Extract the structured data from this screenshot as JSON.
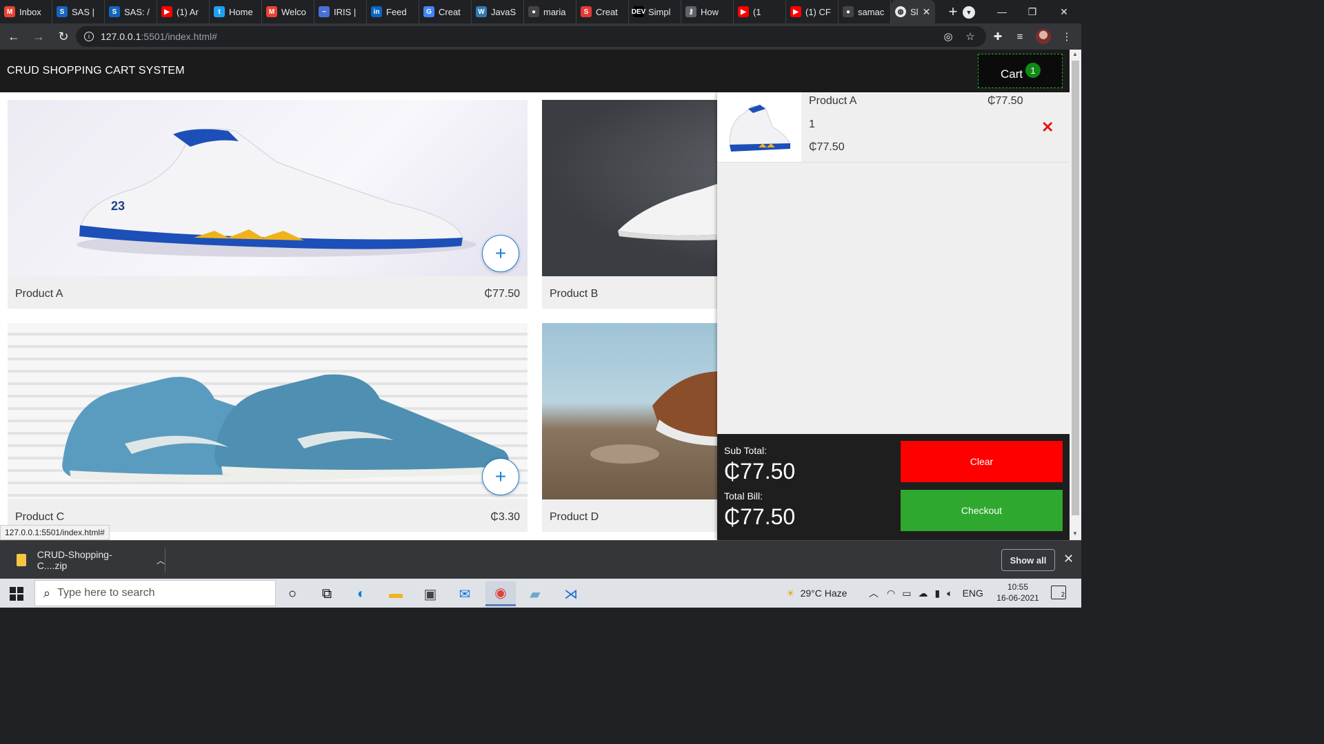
{
  "browser": {
    "tabs": [
      {
        "label": "Inbox",
        "icon": "gmail-icon",
        "color": "#ea4335",
        "glyph": "M"
      },
      {
        "label": "SAS |",
        "icon": "sas-icon",
        "color": "#1565c0",
        "glyph": "S"
      },
      {
        "label": "SAS: /",
        "icon": "sas-icon",
        "color": "#1565c0",
        "glyph": "S"
      },
      {
        "label": "(1) Ar",
        "icon": "youtube-icon",
        "color": "#ff0000",
        "glyph": "▶"
      },
      {
        "label": "Home",
        "icon": "twitter-icon",
        "color": "#1da1f2",
        "glyph": "t"
      },
      {
        "label": "Welco",
        "icon": "gmail-icon",
        "color": "#ea4335",
        "glyph": "M"
      },
      {
        "label": "IRIS |",
        "icon": "iris-icon",
        "color": "#4a6fd8",
        "glyph": "~"
      },
      {
        "label": "Feed",
        "icon": "linkedin-icon",
        "color": "#0a66c2",
        "glyph": "in"
      },
      {
        "label": "Creat",
        "icon": "google-icon",
        "color": "#4285f4",
        "glyph": "G"
      },
      {
        "label": "JavaS",
        "icon": "w3-icon",
        "color": "#2f7bb0",
        "glyph": "W"
      },
      {
        "label": "maria",
        "icon": "github-icon",
        "color": "#444444",
        "glyph": "●"
      },
      {
        "label": "Creat",
        "icon": "scribd-icon",
        "color": "#e53935",
        "glyph": "S"
      },
      {
        "label": "Simpl",
        "icon": "dev-icon",
        "color": "#000000",
        "glyph": "DEV"
      },
      {
        "label": "How",
        "icon": "key-icon",
        "color": "#5f6368",
        "glyph": "⚷"
      },
      {
        "label": "(1",
        "icon": "youtube-icon",
        "color": "#ff0000",
        "glyph": "▶"
      },
      {
        "label": "(1) CF",
        "icon": "youtube-icon",
        "color": "#ff0000",
        "glyph": "▶"
      },
      {
        "label": "samac",
        "icon": "github-icon",
        "color": "#444444",
        "glyph": "●"
      }
    ],
    "active_tab": {
      "label": "Sl",
      "icon": "globe-icon"
    },
    "url_host": "127.0.0.1",
    "url_path": ":5501/index.html#",
    "status_url": "127.0.0.1:5501/index.html#"
  },
  "site": {
    "title": "CRUD SHOPPING CART SYSTEM",
    "cart_label": "Cart",
    "cart_count": "1"
  },
  "products": [
    {
      "name": "Product A",
      "price": "₵77.50"
    },
    {
      "name": "Product B",
      "price": ""
    },
    {
      "name": "Product C",
      "price": "₵3.30"
    },
    {
      "name": "Product D",
      "price": ""
    }
  ],
  "add_symbol": "+",
  "cart": {
    "items": [
      {
        "name": "Product A",
        "unit_price": "₵77.50",
        "qty": "1",
        "line_total": "₵77.50"
      }
    ],
    "remove_symbol": "✕",
    "subtotal_label": "Sub Total:",
    "subtotal": "₵77.50",
    "total_label": "Total Bill:",
    "total": "₵77.50",
    "clear_label": "Clear",
    "checkout_label": "Checkout"
  },
  "downloads": {
    "file": "CRUD-Shopping-C....zip",
    "show_all": "Show all"
  },
  "taskbar": {
    "search_placeholder": "Type here to search",
    "weather": "29°C  Haze",
    "lang": "ENG",
    "time": "10:55",
    "date": "16-06-2021",
    "notifications": "2"
  }
}
